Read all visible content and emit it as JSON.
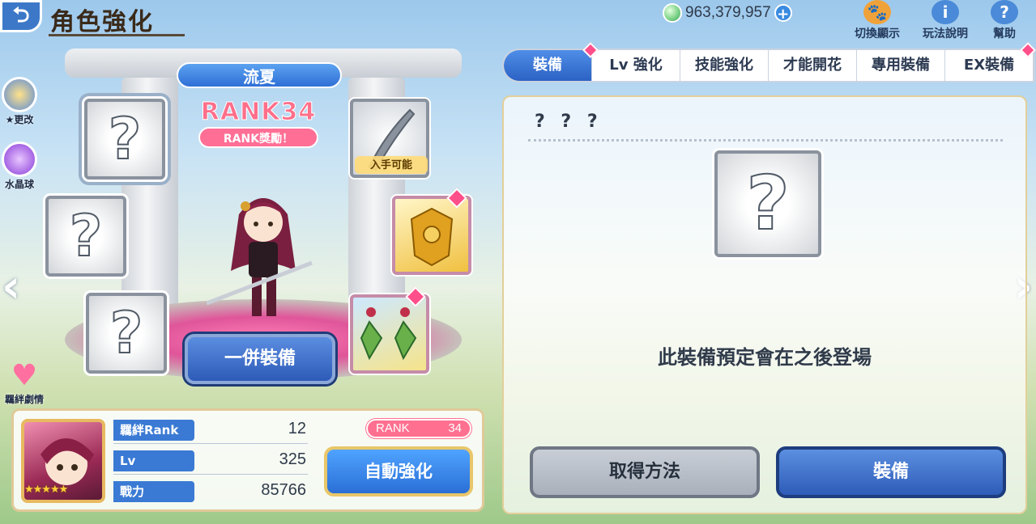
{
  "header": {
    "back_icon": "back-arrow-icon",
    "title": "角色強化",
    "currency_value": "963,379,957",
    "plus_icon": "+",
    "toggle_label": "切換顯示",
    "rules_label": "玩法說明",
    "help_label": "幫助"
  },
  "sidebar": {
    "star_change_label": "★更改",
    "crystal_label": "水晶球",
    "bond_label": "羈絆劇情"
  },
  "character": {
    "name": "流夏",
    "rank_title": "RANK34",
    "rank_reward_label": "RANK獎勵！",
    "obtainable_label": "入手可能",
    "equip_all_label": "一併裝備",
    "empty_slot_symbol": "?",
    "rarity_stars": "★★★★★"
  },
  "stats": {
    "bond_label": "羈絆Rank",
    "bond_value": "12",
    "level_label": "Lv",
    "level_value": "325",
    "power_label": "戰力",
    "power_value": "85766",
    "rank_label": "RANK",
    "rank_value": "34",
    "auto_enhance_label": "自動強化"
  },
  "tabs": [
    {
      "label": "裝備"
    },
    {
      "label": "Lv 強化"
    },
    {
      "label": "技能強化"
    },
    {
      "label": "才能開花"
    },
    {
      "label": "專用裝備"
    },
    {
      "label": "EX裝備"
    }
  ],
  "detail": {
    "item_name": "? ? ?",
    "empty_symbol": "?",
    "message": "此裝備預定會在之後登場",
    "acquire_label": "取得方法",
    "equip_label": "裝備"
  },
  "nav": {
    "left": "‹",
    "right": "›"
  },
  "colors": {
    "accent_blue": "#2f6fd6",
    "rank_pink": "#ff6f8a",
    "gold_border": "#e8c66a"
  }
}
